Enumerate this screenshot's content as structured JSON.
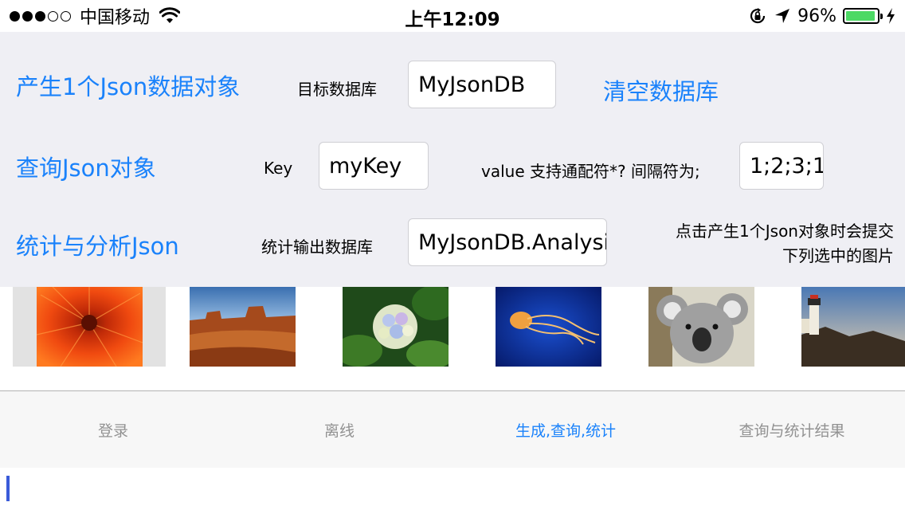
{
  "status_bar": {
    "carrier": "中国移动",
    "time": "上午12:09",
    "battery": "96%",
    "battery_level": 0.96,
    "icons": [
      "signal-dots-icon",
      "wifi-icon",
      "orientation-lock-icon",
      "location-arrow-icon",
      "battery-icon",
      "charging-bolt-icon"
    ]
  },
  "row1": {
    "generate_button": "产生1个Json数据对象",
    "target_db_label": "目标数据库",
    "target_db_value": "MyJsonDB",
    "clear_button": "清空数据库"
  },
  "row2": {
    "query_button": "查询Json对象",
    "key_label": "Key",
    "key_value": "myKey",
    "value_label": "value 支持通配符*? 间隔符为;",
    "value_value": "1;2;3;1"
  },
  "row3": {
    "stats_button": "统计与分析Json",
    "output_db_label": "统计输出数据库",
    "output_db_value": "MyJsonDB.Analysis",
    "note_line1": "点击产生1个Json对象时会提交",
    "note_line2": "下列选中的图片"
  },
  "images": [
    {
      "name": "chrysanthemum-image",
      "selected": true
    },
    {
      "name": "desert-image",
      "selected": false
    },
    {
      "name": "hydrangeas-image",
      "selected": false
    },
    {
      "name": "jellyfish-image",
      "selected": false
    },
    {
      "name": "koala-image",
      "selected": false
    },
    {
      "name": "lighthouse-image",
      "selected": false
    }
  ],
  "tabs": [
    {
      "label": "登录",
      "active": false
    },
    {
      "label": "离线",
      "active": false
    },
    {
      "label": "生成,查询,统计",
      "active": true
    },
    {
      "label": "查询与统计结果",
      "active": false
    }
  ],
  "colors": {
    "accent": "#1a82fb",
    "panel_bg": "#efeff4",
    "battery_green": "#4cd964"
  }
}
